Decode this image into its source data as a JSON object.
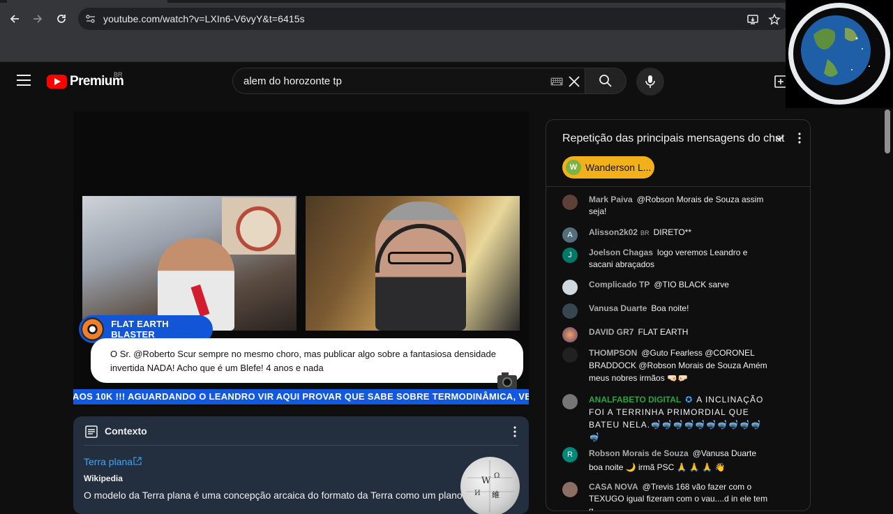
{
  "browser": {
    "url": "youtube.com/watch?v=LXIn6-V6vyY&t=6415s"
  },
  "youtube": {
    "logo_text": "Premium",
    "country_code": "BR",
    "search_query": "alem do horozonte tp"
  },
  "video_overlay": {
    "host_name": "FLAT EARTH BLASTER",
    "message": "O Sr. @Roberto Scur sempre no mesmo choro, mas publicar algo sobre a fantasiosa densidade invertida NADA! Acho que é um Blefe! 4 anos e nada",
    "ticker": "AOS 10K !!! AGUARDANDO O LEANDRO VIR AQUI PROVAR QUE SABE SOBRE TERMODINÂMICA, VEM PAI"
  },
  "context_card": {
    "title": "Contexto",
    "link": "Terra plana",
    "source": "Wikipedia",
    "description": "O modelo da Terra plana é uma concepção arcaica do formato da Terra como um plano ou"
  },
  "chat": {
    "title": "Repetição das principais mensagens do chat",
    "pinned": {
      "initial": "W",
      "name": "Wanderson L..."
    },
    "messages": [
      {
        "author": "Mark Paiva",
        "text": "@Robson Morais de Souza assim seja!",
        "avatar": "",
        "color": "#5d4037"
      },
      {
        "author": "Alisson2k02",
        "badge": "BR",
        "text": "DIRETO**",
        "avatar": "A",
        "color": "#546e7a"
      },
      {
        "author": "Joelson Chagas",
        "text": "logo veremos Leandro e sacani abraçados",
        "avatar": "J",
        "color": "#00796b"
      },
      {
        "author": "Complicado TP",
        "text": "@TIO BLACK sarve",
        "avatar": "",
        "color": "#cfd8dc"
      },
      {
        "author": "Vanusa Duarte",
        "text": "Boa noite!",
        "avatar": "",
        "color": "#37474f"
      },
      {
        "author": "DAVID GR7",
        "text": "FLAT EARTH",
        "avatar": "",
        "color": "#8e6f9e"
      },
      {
        "author": "THOMPSON",
        "text": "@Guto Fearless @CORONEL BRADDOCK @Robson Morais de Souza Amém meus nobres irmãos 🤜🏻🤛🏻",
        "avatar": "",
        "color": "#212121"
      },
      {
        "author": "ANALFABETO DIGITAL",
        "text": "A INCLINAÇÃO FOI A TERRINHA PRIMORDIAL QUE BATEU NELA.🤿🤿🤿🤿🤿🤿🤿🤿🤿🤿🤿",
        "avatar": "",
        "color": "#757575"
      },
      {
        "author": "Robson Morais de Souza",
        "text": "@Vanusa Duarte boa noite 🌙 irmã PSC 🙏 🙏 🙏 👋",
        "avatar": "R",
        "color": "#00897b"
      },
      {
        "author": "CASA NOVA",
        "text": "@Trevis 168 vão fazer com o TEXUGO igual fizeram com o vau....d in ele tem q",
        "avatar": "",
        "color": "#8d6e63"
      }
    ]
  }
}
